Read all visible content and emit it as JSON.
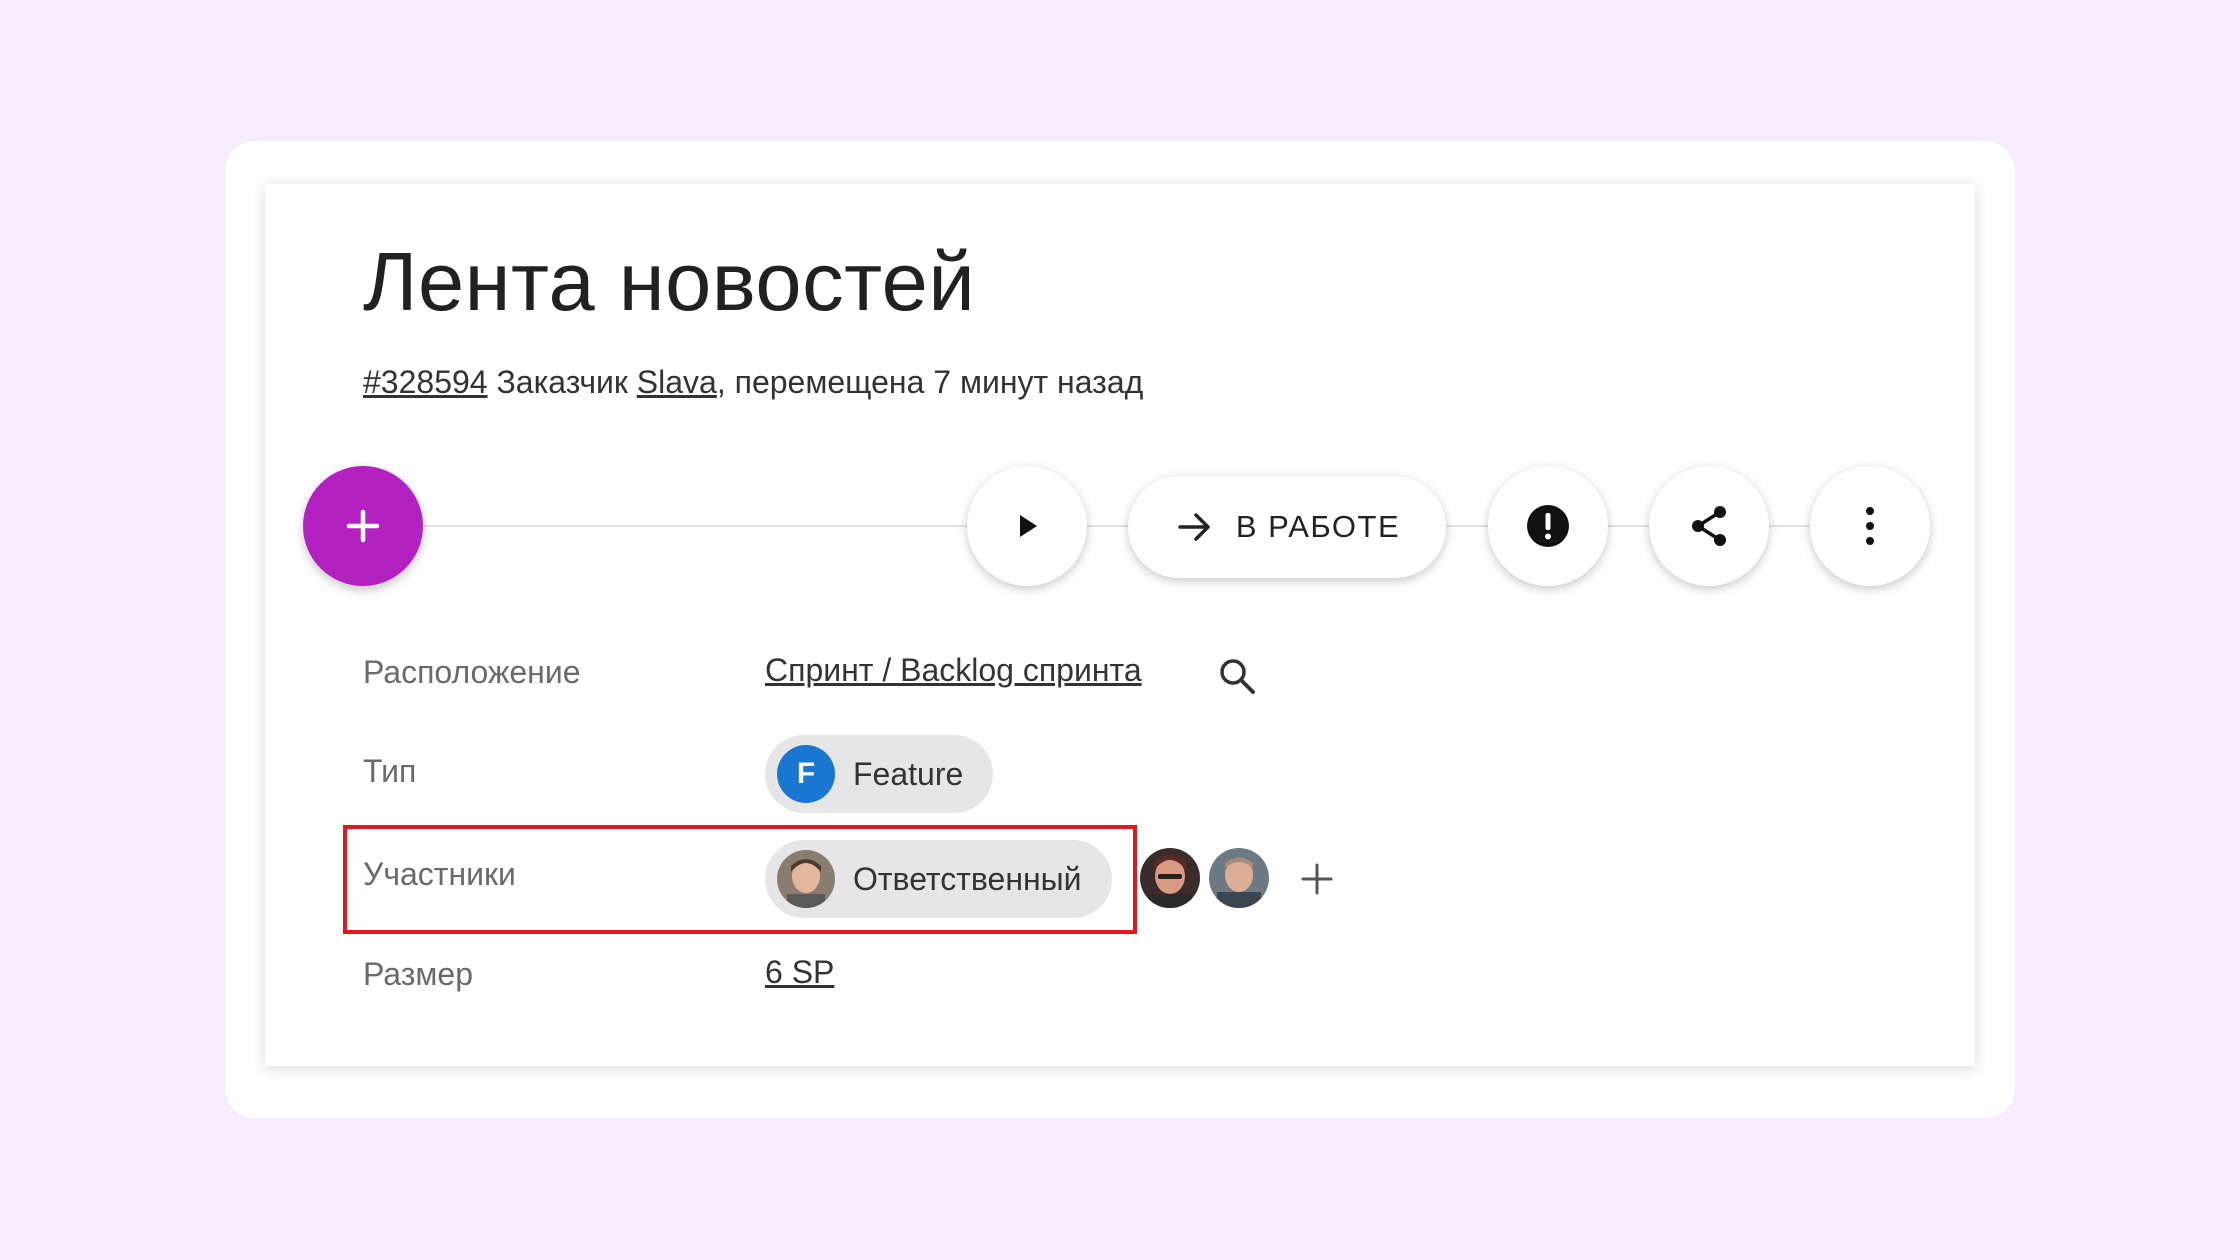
{
  "task": {
    "title": "Лента новостей",
    "id_link": "#328594",
    "customer_prefix": "Заказчик",
    "customer_link": "Slava",
    "moved_text": ", перемещена 7 минут назад"
  },
  "toolbar": {
    "add_icon": "plus-icon",
    "play_icon": "play-icon",
    "status_icon": "arrow-right-icon",
    "status_label": "В РАБОТЕ",
    "alert_icon": "alert-circle-icon",
    "share_icon": "share-icon",
    "more_icon": "more-vertical-icon"
  },
  "fields": {
    "location": {
      "label": "Расположение",
      "value": "Спринт / Backlog спринта",
      "search_icon": "search-icon"
    },
    "type": {
      "label": "Тип",
      "badge": "F",
      "value": "Feature",
      "badge_color": "#1976d2"
    },
    "members": {
      "label": "Участники",
      "assignee_role": "Ответственный",
      "add_icon": "plus-icon"
    },
    "size": {
      "label": "Размер",
      "value": "6 SP"
    }
  },
  "colors": {
    "fab": "#b322c1",
    "highlight": "#e3171d",
    "background": "#f5ecfd"
  }
}
